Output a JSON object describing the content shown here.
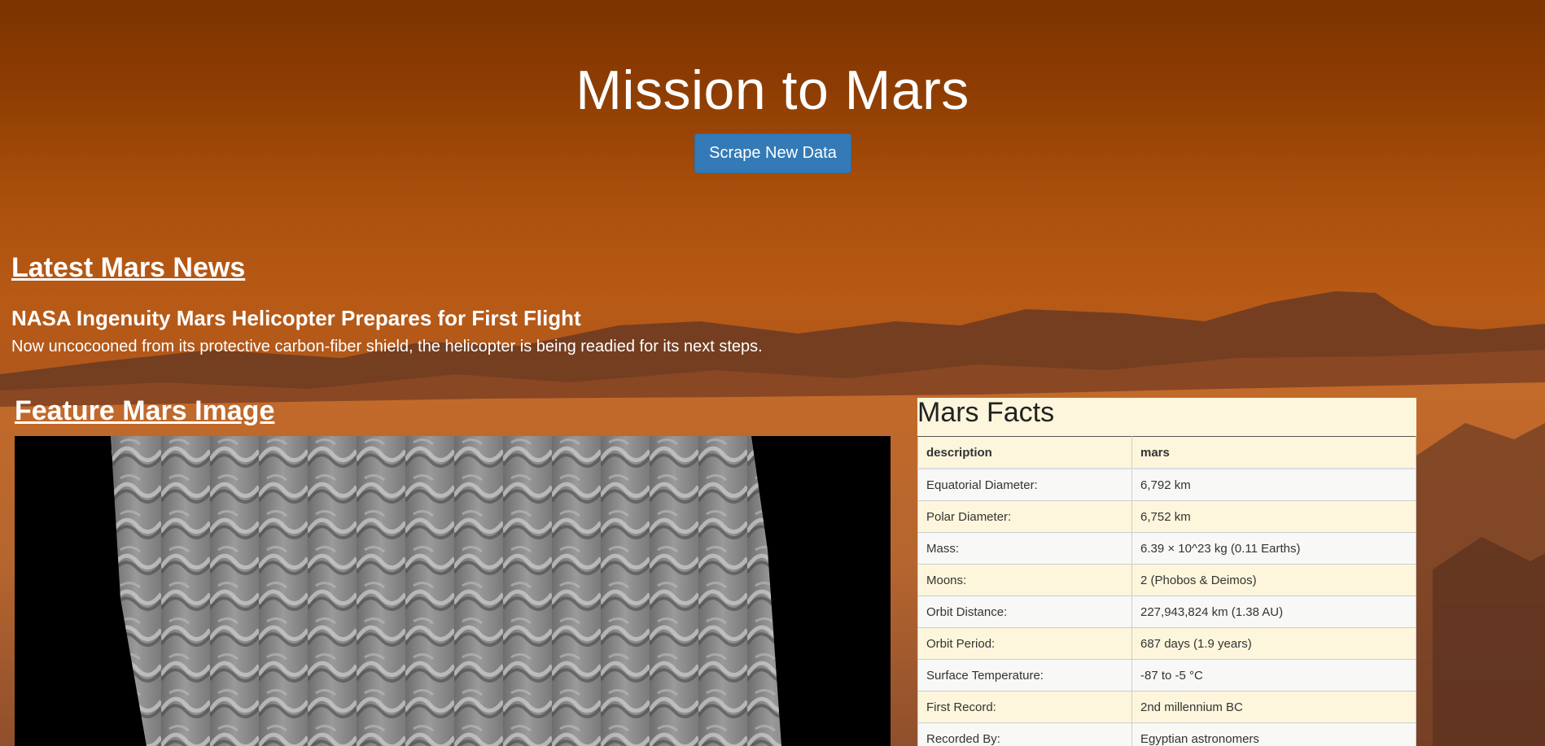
{
  "header": {
    "title": "Mission to Mars",
    "scrape_button": "Scrape New Data"
  },
  "news": {
    "heading": "Latest Mars News",
    "title": "NASA Ingenuity Mars Helicopter Prepares for First Flight",
    "teaser": "Now uncocooned from its protective carbon-fiber shield, the helicopter is being readied for its next steps."
  },
  "feature": {
    "heading": "Feature Mars Image"
  },
  "facts": {
    "heading": "Mars Facts",
    "columns": [
      "description",
      "mars"
    ],
    "rows": [
      [
        "Equatorial Diameter:",
        "6,792 km"
      ],
      [
        "Polar Diameter:",
        "6,752 km"
      ],
      [
        "Mass:",
        "6.39 × 10^23 kg (0.11 Earths)"
      ],
      [
        "Moons:",
        "2 (Phobos & Deimos)"
      ],
      [
        "Orbit Distance:",
        "227,943,824 km (1.38 AU)"
      ],
      [
        "Orbit Period:",
        "687 days (1.9 years)"
      ],
      [
        "Surface Temperature:",
        "-87 to -5 °C"
      ],
      [
        "First Record:",
        "2nd millennium BC"
      ],
      [
        "Recorded By:",
        "Egyptian astronomers"
      ]
    ]
  },
  "colors": {
    "button": "#337ab7",
    "facts_background": "#fdf6dc",
    "sky_top": "#7c3300"
  }
}
